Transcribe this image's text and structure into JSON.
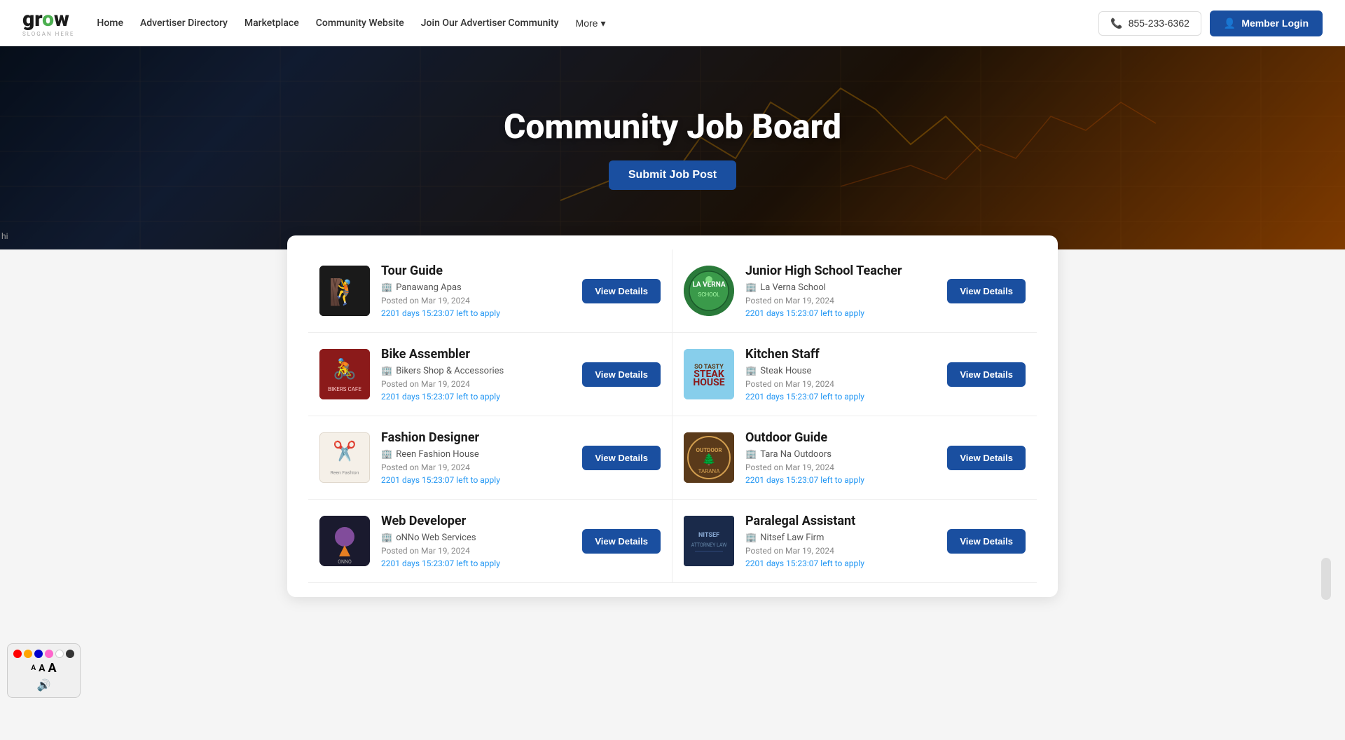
{
  "logo": {
    "text": "grow",
    "slogan": "SLOGAN HERE"
  },
  "nav": {
    "home": "Home",
    "advertiser_directory": "Advertiser Directory",
    "marketplace": "Marketplace",
    "community_website": "Community Website",
    "join_community": "Join Our Advertiser Community",
    "more": "More",
    "phone": "855-233-6362",
    "login": "Member Login"
  },
  "hero": {
    "title": "Community Job Board",
    "submit_btn": "Submit Job Post"
  },
  "jobs": [
    {
      "id": 1,
      "title": "Tour Guide",
      "company": "Panawang Apas",
      "posted": "Posted on Mar 19, 2024",
      "days": "2201",
      "timer": "15:23:07",
      "timer_suffix": "left to apply",
      "logo_type": "tour"
    },
    {
      "id": 2,
      "title": "Junior High School Teacher",
      "company": "La Verna School",
      "posted": "Posted on Mar 19, 2024",
      "days": "2201",
      "timer": "15:23:07",
      "timer_suffix": "left to apply",
      "logo_type": "laverna"
    },
    {
      "id": 3,
      "title": "Bike Assembler",
      "company": "Bikers Shop & Accessories",
      "posted": "Posted on Mar 19, 2024",
      "days": "2201",
      "timer": "15:23:07",
      "timer_suffix": "left to apply",
      "logo_type": "bikers"
    },
    {
      "id": 4,
      "title": "Kitchen Staff",
      "company": "Steak House",
      "posted": "Posted on Mar 19, 2024",
      "days": "2201",
      "timer": "15:23:07",
      "timer_suffix": "left to apply",
      "logo_type": "steak"
    },
    {
      "id": 5,
      "title": "Fashion Designer",
      "company": "Reen Fashion House",
      "posted": "Posted on Mar 19, 2024",
      "days": "2201",
      "timer": "15:23:07",
      "timer_suffix": "left to apply",
      "logo_type": "fashion"
    },
    {
      "id": 6,
      "title": "Outdoor Guide",
      "company": "Tara Na Outdoors",
      "posted": "Posted on Mar 19, 2024",
      "days": "2201",
      "timer": "15:23:07",
      "timer_suffix": "left to apply",
      "logo_type": "outdoor"
    },
    {
      "id": 7,
      "title": "Web Developer",
      "company": "oNNo Web Services",
      "posted": "Posted on Mar 19, 2024",
      "days": "2201",
      "timer": "15:23:07",
      "timer_suffix": "left to apply",
      "logo_type": "onno"
    },
    {
      "id": 8,
      "title": "Paralegal Assistant",
      "company": "Nitsef Law Firm",
      "posted": "Posted on Mar 19, 2024",
      "days": "2201",
      "timer": "15:23:07",
      "timer_suffix": "left to apply",
      "logo_type": "nitsef"
    }
  ],
  "view_details_label": "View Details"
}
